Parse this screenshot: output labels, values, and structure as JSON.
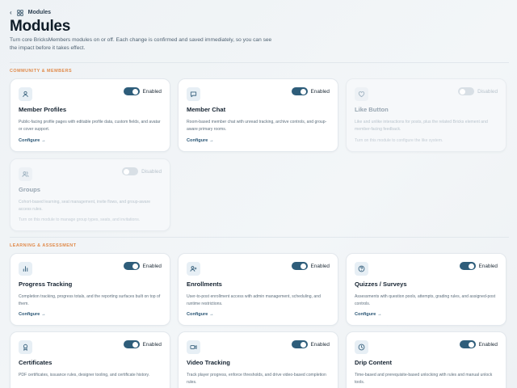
{
  "breadcrumb": {
    "back_glyph": "‹",
    "label": "Modules",
    "icon": "grid-icon"
  },
  "page": {
    "title": "Modules",
    "description": "Turn core BricksMembers modules on or off. Each change is confirmed and saved immediately, so you can see the impact before it takes effect."
  },
  "colors": {
    "accent": "#2e5d7a",
    "section_label": "#e08a4a",
    "toggle_off": "#d8dfe5"
  },
  "sections": [
    {
      "label": "COMMUNITY & MEMBERS",
      "cards": [
        {
          "title": "Member Profiles",
          "icon": "user-icon",
          "enabled": true,
          "status": "Enabled",
          "description": "Public-facing profile pages with editable profile data, custom fields, and avatar or cover support.",
          "link": "Configure →"
        },
        {
          "title": "Member Chat",
          "icon": "chat-icon",
          "enabled": true,
          "status": "Enabled",
          "description": "Room-based member chat with unread tracking, archive controls, and group-aware primary rooms.",
          "link": "Configure →"
        },
        {
          "title": "Like Button",
          "icon": "heart-icon",
          "enabled": false,
          "status": "Disabled",
          "description": "Like and unlike interactions for posts, plus the related Bricks element and member-facing feedback.",
          "hint": "Turn on this module to configure the like system."
        },
        {
          "title": "Groups",
          "icon": "users-icon",
          "enabled": false,
          "status": "Disabled",
          "description": "Cohort-based learning, seat management, invite flows, and group-aware access rules.",
          "hint": "Turn on this module to manage group types, seats, and invitations."
        }
      ]
    },
    {
      "label": "LEARNING & ASSESSMENT",
      "cards": [
        {
          "title": "Progress Tracking",
          "icon": "bar-chart-icon",
          "enabled": true,
          "status": "Enabled",
          "description": "Completion tracking, progress totals, and the reporting surfaces built on top of them.",
          "link": "Configure →"
        },
        {
          "title": "Enrollments",
          "icon": "user-plus-icon",
          "enabled": true,
          "status": "Enabled",
          "description": "User-to-post enrollment access with admin management, scheduling, and runtime restrictions.",
          "link": "Configure →"
        },
        {
          "title": "Quizzes / Surveys",
          "icon": "question-icon",
          "enabled": true,
          "status": "Enabled",
          "description": "Assessments with question pools, attempts, grading rules, and assigned-post controls.",
          "link": "Configure →"
        },
        {
          "title": "Certificates",
          "icon": "award-icon",
          "enabled": true,
          "status": "Enabled",
          "description": "PDF certificates, issuance rules, designer tooling, and certificate history.",
          "link": ""
        },
        {
          "title": "Video Tracking",
          "icon": "video-icon",
          "enabled": true,
          "status": "Enabled",
          "description": "Track player progress, enforce thresholds, and drive video-based completion rules.",
          "link": ""
        },
        {
          "title": "Drip Content",
          "icon": "clock-icon",
          "enabled": true,
          "status": "Enabled",
          "description": "Time-based and prerequisite-based unlocking with rules and manual unlock tools.",
          "link": ""
        }
      ]
    }
  ]
}
